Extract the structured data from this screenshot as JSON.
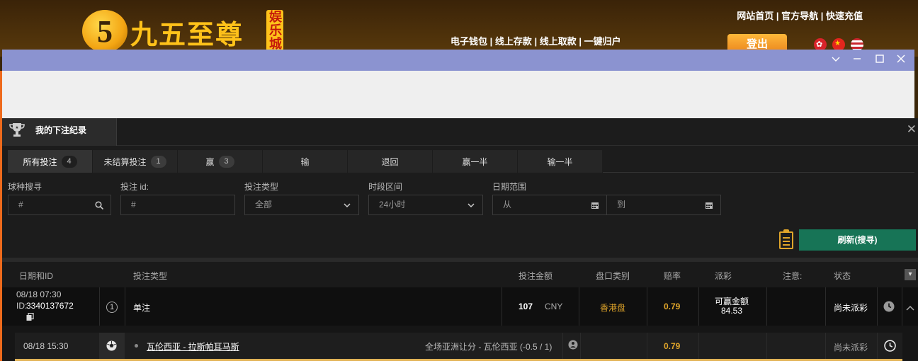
{
  "site": {
    "logo_digit": "5",
    "logo_text": "九五至尊",
    "logo_tag": "娱乐城",
    "top_links": [
      "网站首页",
      "官方导航",
      "快速充值"
    ],
    "nav_links": [
      "电子钱包",
      "线上存款",
      "线上取款",
      "一键归户"
    ],
    "logout_label": "登出"
  },
  "window": {
    "controls": [
      "chevron-down",
      "minimize",
      "maximize",
      "close"
    ],
    "titlebar_color": "#8b93d0"
  },
  "panel": {
    "title": "我的下注纪录",
    "filter_tabs": [
      {
        "label": "所有投注",
        "count": "4",
        "active": true
      },
      {
        "label": "未结算投注",
        "count": "1"
      },
      {
        "label": "赢",
        "count": "3"
      },
      {
        "label": "输",
        "count": ""
      },
      {
        "label": "退回",
        "count": ""
      },
      {
        "label": "赢一半",
        "count": ""
      },
      {
        "label": "输一半",
        "count": ""
      }
    ],
    "filters": {
      "sport": {
        "label": "球种搜寻",
        "placeholder": "#"
      },
      "bet_id": {
        "label": "投注 id:",
        "placeholder": "#"
      },
      "bet_type": {
        "label": "投注类型",
        "value": "全部"
      },
      "period": {
        "label": "时段区间",
        "value": "24小时"
      },
      "date_range": {
        "label": "日期范围",
        "from": "从",
        "to": "到"
      }
    },
    "refresh_label": "刷新(搜寻)",
    "accent_green": "#177456",
    "accent_orange": "#e0a52a"
  },
  "table": {
    "headers": {
      "date_id": "日期和ID",
      "bet_type": "投注类型",
      "amount": "投注金额",
      "market": "盘口类别",
      "odds": "赔率",
      "payout": "派彩",
      "note": "注意:",
      "status": "状态"
    },
    "bet": {
      "date": "08/18 07:30",
      "id_prefix": "ID:",
      "id": "3340137672",
      "index": "1",
      "type": "单注",
      "amount": "107",
      "currency": "CNY",
      "market": "香港盘",
      "odds": "0.79",
      "payout_label": "可赢金额",
      "payout_value": "84.53",
      "status": "尚未派彩"
    },
    "leg": {
      "date": "08/18 15:30",
      "match": "瓦伦西亚 - 拉斯帕耳马斯",
      "selection": "全场亚洲让分 - 瓦伦西亚 (-0.5 / 1)",
      "odds": "0.79",
      "status": "尚未派彩"
    }
  }
}
